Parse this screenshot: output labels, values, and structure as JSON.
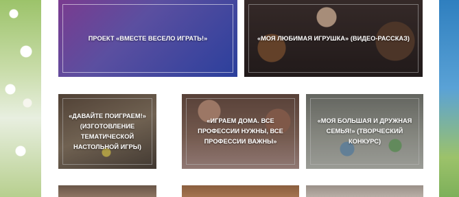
{
  "cards": [
    {
      "title": "ПРОЕКТ «ВМЕСТЕ ВЕСЕЛО ИГРАТЬ!»"
    },
    {
      "title": "«МОЯ ЛЮБИМАЯ ИГРУШКА» (ВИДЕО-РАССКАЗ)"
    },
    {
      "title": "«ДАВАЙТЕ ПОИГРАЕМ!» (ИЗГОТОВЛЕНИЕ ТЕМАТИЧЕСКОЙ НАСТОЛЬНОЙ ИГРЫ)"
    },
    {
      "title": "«ИГРАЕМ ДОМА. ВСЕ ПРОФЕССИИ НУЖНЫ, ВСЕ ПРОФЕССИИ ВАЖНЫ»"
    },
    {
      "title": "«МОЯ БОЛЬШАЯ И ДРУЖНАЯ СЕМЬЯ!» (ТВОРЧЕСКИЙ КОНКУРС)"
    }
  ]
}
